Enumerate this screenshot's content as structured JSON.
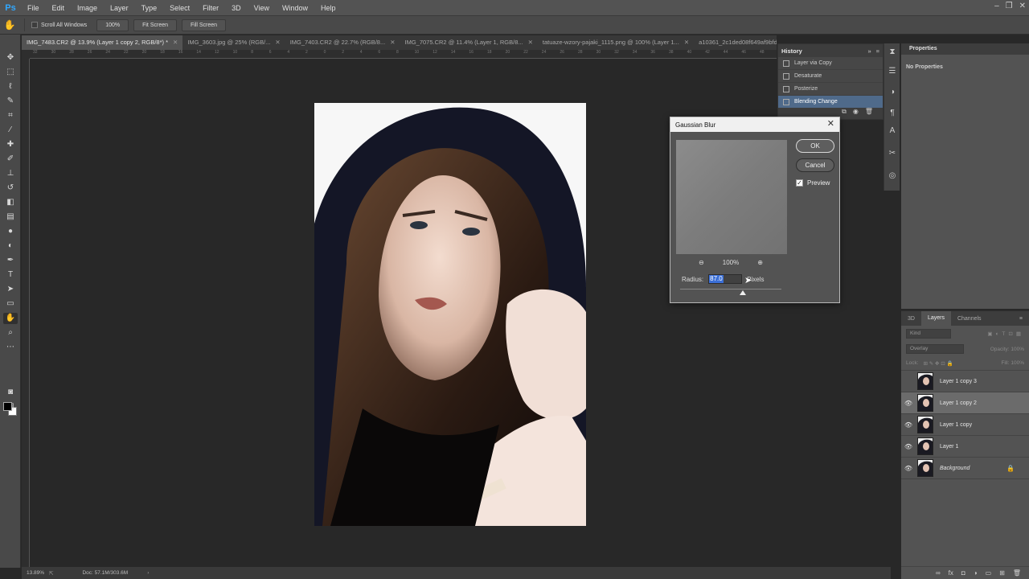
{
  "app": {
    "logo": "Ps"
  },
  "menu": [
    "File",
    "Edit",
    "Image",
    "Layer",
    "Type",
    "Select",
    "Filter",
    "3D",
    "View",
    "Window",
    "Help"
  ],
  "window_controls": {
    "minimize": "–",
    "restore": "❐",
    "close": "✕"
  },
  "options_bar": {
    "scroll_all_label": "Scroll All Windows",
    "zoom_btn": "100%",
    "fit_btn": "Fit Screen",
    "fill_btn": "Fill Screen"
  },
  "tabs": [
    {
      "label": "IMG_7483.CR2 @ 13.9% (Layer 1 copy 2, RGB/8*) *",
      "active": true
    },
    {
      "label": "IMG_3603.jpg @ 25% (RGB/...",
      "active": false
    },
    {
      "label": "IMG_7403.CR2 @ 22.7% (RGB/8...",
      "active": false
    },
    {
      "label": "IMG_7075.CR2 @ 11.4% (Layer 1, RGB/8...",
      "active": false
    },
    {
      "label": "tatuaze-wzory-pajaki_1115.png @ 100% (Layer 1...",
      "active": false
    },
    {
      "label": "a10361_2c1ded08f649af9bfd...",
      "active": false
    }
  ],
  "ruler_top": [
    "32",
    "30",
    "28",
    "26",
    "24",
    "22",
    "20",
    "18",
    "16",
    "14",
    "12",
    "10",
    "8",
    "6",
    "4",
    "2",
    "0",
    "2",
    "4",
    "6",
    "8",
    "10",
    "12",
    "14",
    "16",
    "18",
    "20",
    "22",
    "24",
    "26",
    "28",
    "30",
    "32",
    "34",
    "36",
    "38",
    "40",
    "42",
    "44",
    "46",
    "48"
  ],
  "status": {
    "zoom": "13.89%",
    "doc": "Doc: 57.1M/303.6M"
  },
  "history": {
    "title": "History",
    "items": [
      {
        "label": "Layer via Copy",
        "active": false
      },
      {
        "label": "Desaturate",
        "active": false
      },
      {
        "label": "Posterize",
        "active": false
      },
      {
        "label": "Blending Change",
        "active": true
      }
    ]
  },
  "properties": {
    "title": "Properties",
    "text": "No Properties"
  },
  "layers": {
    "tabs": [
      "3D",
      "Layers",
      "Channels"
    ],
    "filter_placeholder": "Kind",
    "blend_mode": "Overlay",
    "opacity_label": "Opacity: 100%",
    "lock_label": "Lock:",
    "fill_label": "Fill: 100%",
    "items": [
      {
        "name": "Layer 1 copy 3",
        "visible": false,
        "selected": false,
        "locked": false,
        "italic": false
      },
      {
        "name": "Layer 1 copy 2",
        "visible": true,
        "selected": true,
        "locked": false,
        "italic": false
      },
      {
        "name": "Layer 1 copy",
        "visible": true,
        "selected": false,
        "locked": false,
        "italic": false
      },
      {
        "name": "Layer 1",
        "visible": true,
        "selected": false,
        "locked": false,
        "italic": false
      },
      {
        "name": "Background",
        "visible": true,
        "selected": false,
        "locked": true,
        "italic": true
      }
    ]
  },
  "dialog": {
    "title": "Gaussian Blur",
    "ok": "OK",
    "cancel": "Cancel",
    "preview_label": "Preview",
    "preview_checked": true,
    "zoom_value": "100%",
    "radius_label": "Radius:",
    "radius_value": "87.0",
    "radius_unit": "Pixels"
  }
}
